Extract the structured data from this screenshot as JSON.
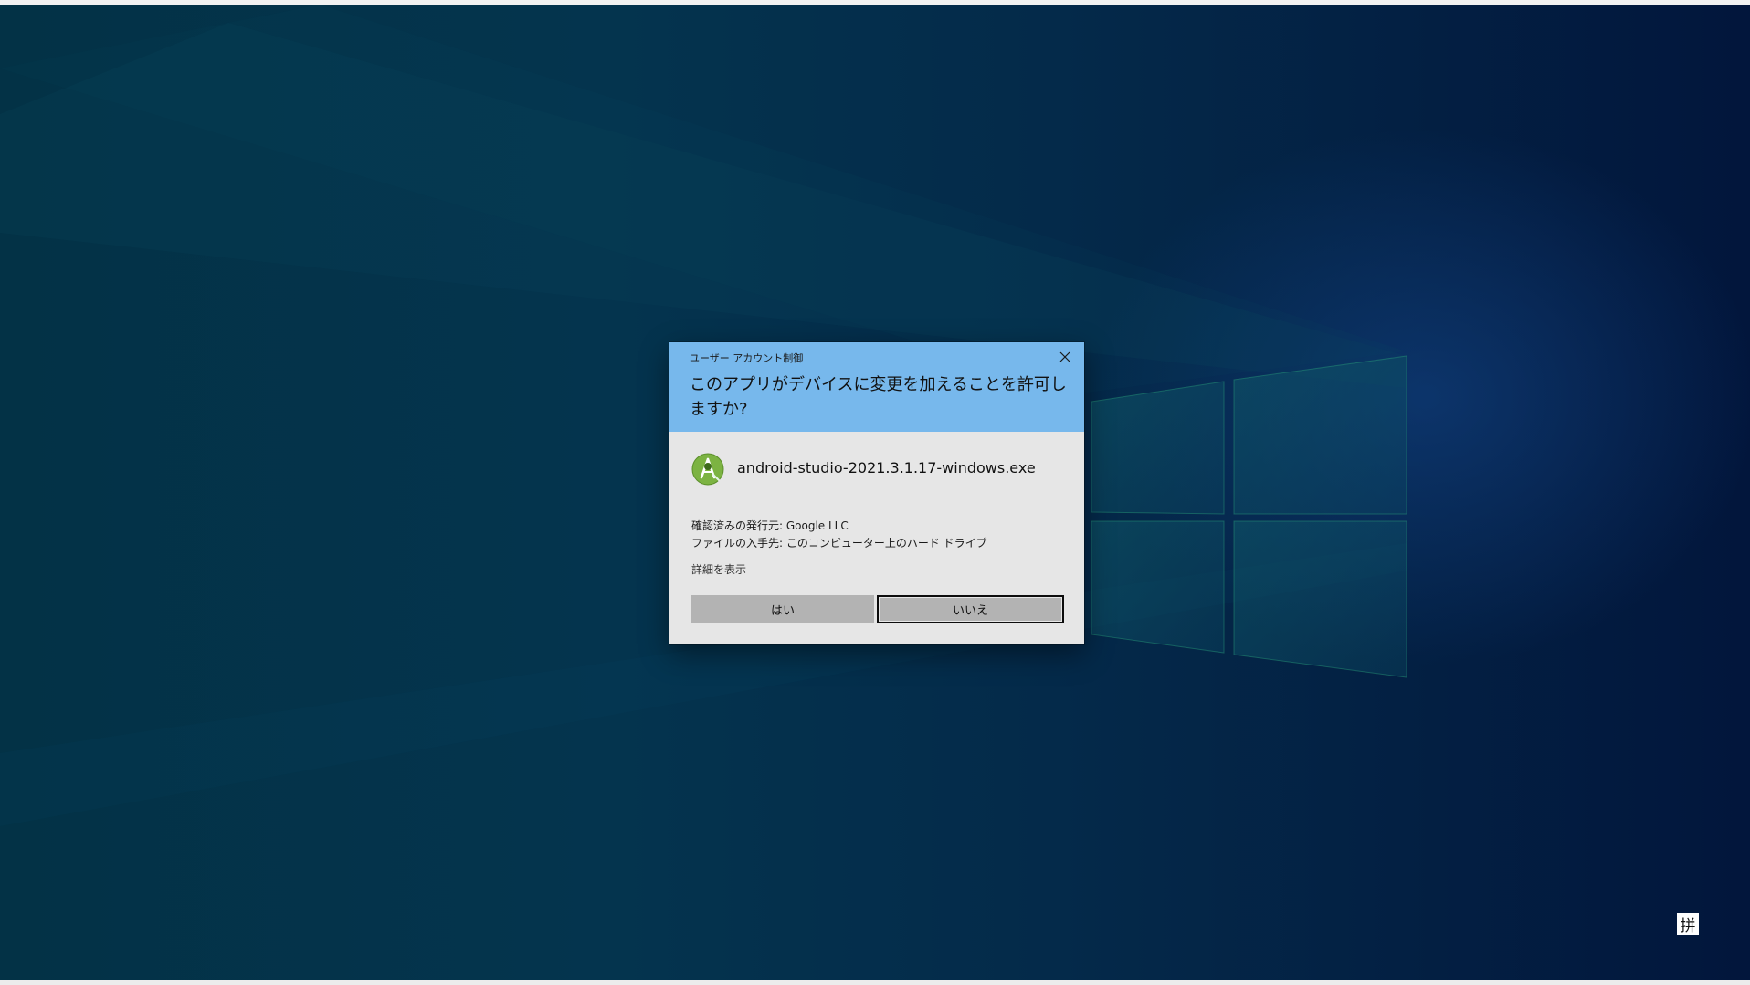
{
  "desktop": {
    "wallpaper": "windows-10-hero-blue",
    "accent_colors": {
      "uac_header": "#77b8ec",
      "uac_body": "#e6e6e6",
      "button": "#b3b3b3",
      "wallpaper_dark": "#02163c",
      "wallpaper_teal": "#04344e"
    }
  },
  "uac": {
    "window_title": "ユーザー アカウント制御",
    "question": "このアプリがデバイスに変更を加えることを許可しますか?",
    "close_icon": "close-icon",
    "app": {
      "icon": "android-studio-icon",
      "name": "android-studio-2021.3.1.17-windows.exe"
    },
    "publisher_line": "確認済みの発行元: Google LLC",
    "origin_line": "ファイルの入手先: このコンピューター上のハード ドライブ",
    "details_link": "詳細を表示",
    "buttons": {
      "yes": "はい",
      "no": "いいえ",
      "focused": "no"
    }
  },
  "taskbar": {
    "ime_indicator": "拼"
  }
}
